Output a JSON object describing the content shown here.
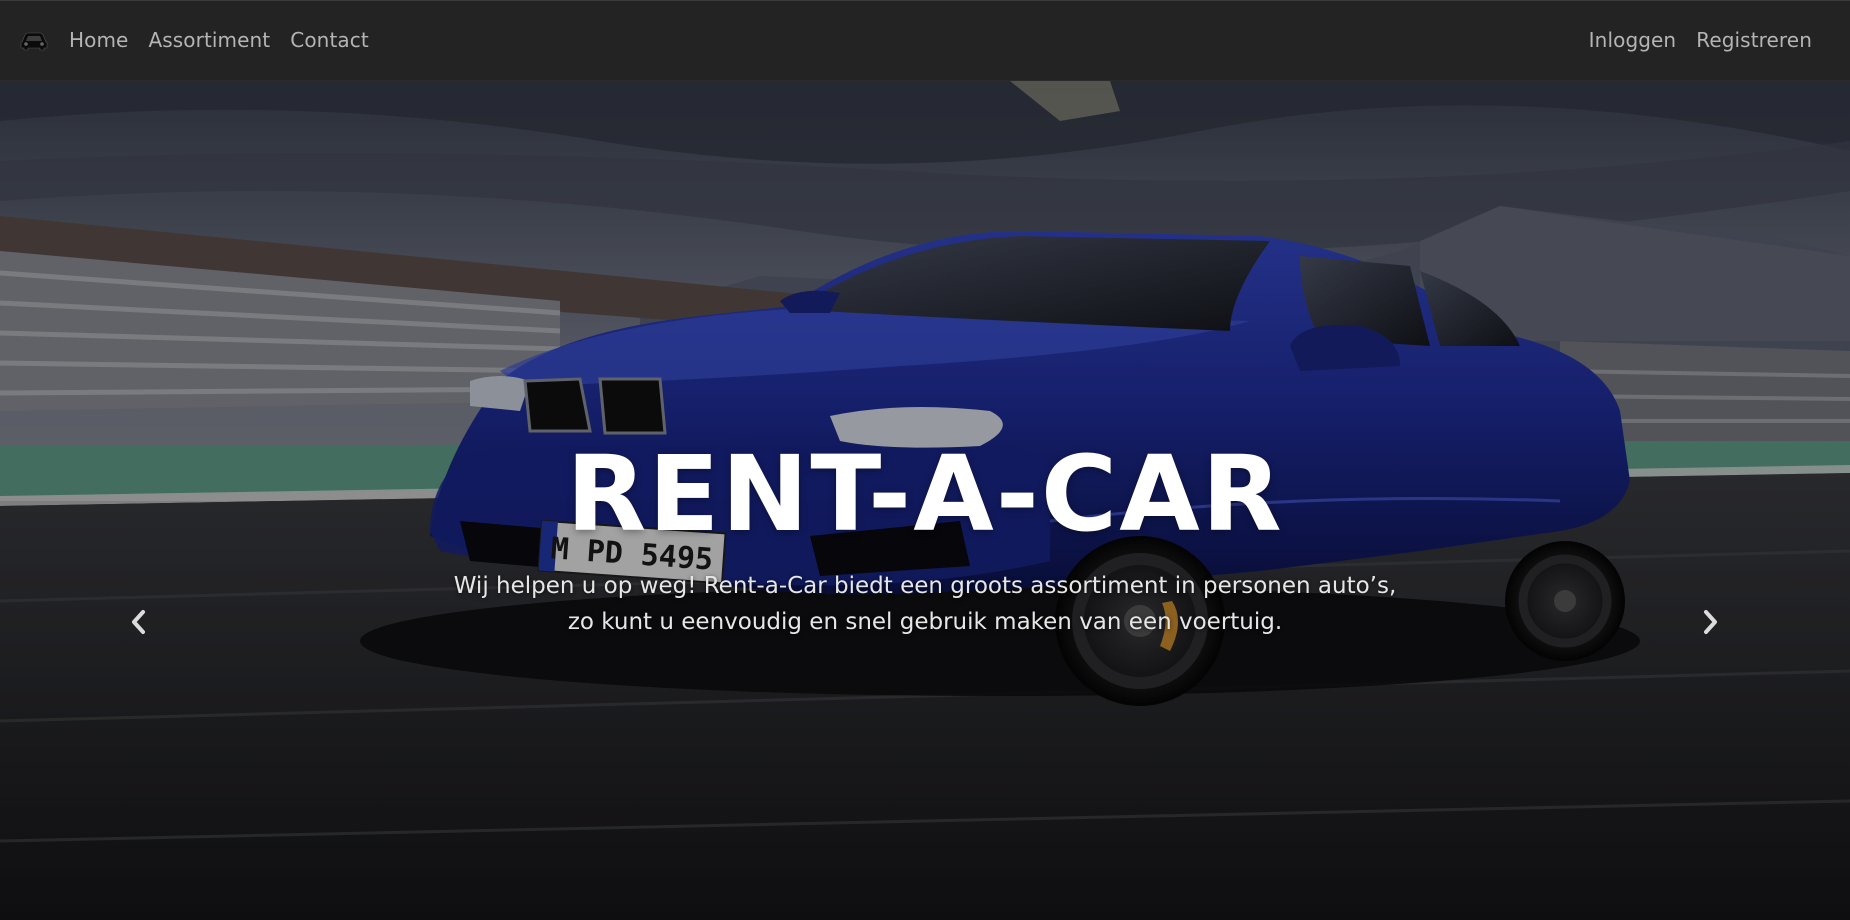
{
  "navbar": {
    "brand_icon": "car-icon",
    "left_links": [
      {
        "label": "Home"
      },
      {
        "label": "Assortiment"
      },
      {
        "label": "Contact"
      }
    ],
    "right_links": [
      {
        "label": "Inloggen"
      },
      {
        "label": "Registreren"
      }
    ]
  },
  "hero": {
    "title": "RENT-A-CAR",
    "text_line1": "Wij helpen u op weg! Rent-a-Car biedt een groots assortiment in personen auto’s,",
    "text_line2": "zo kunt u eenvoudig en snel gebruik maken van een voertuig.",
    "license_plate": "M PD 5495",
    "prev_icon": "chevron-left-icon",
    "next_icon": "chevron-right-icon"
  },
  "colors": {
    "navbar_bg": "#232323",
    "nav_link": "#b4b4b4",
    "car_body": "#1e2f9a",
    "title": "#ffffff"
  }
}
